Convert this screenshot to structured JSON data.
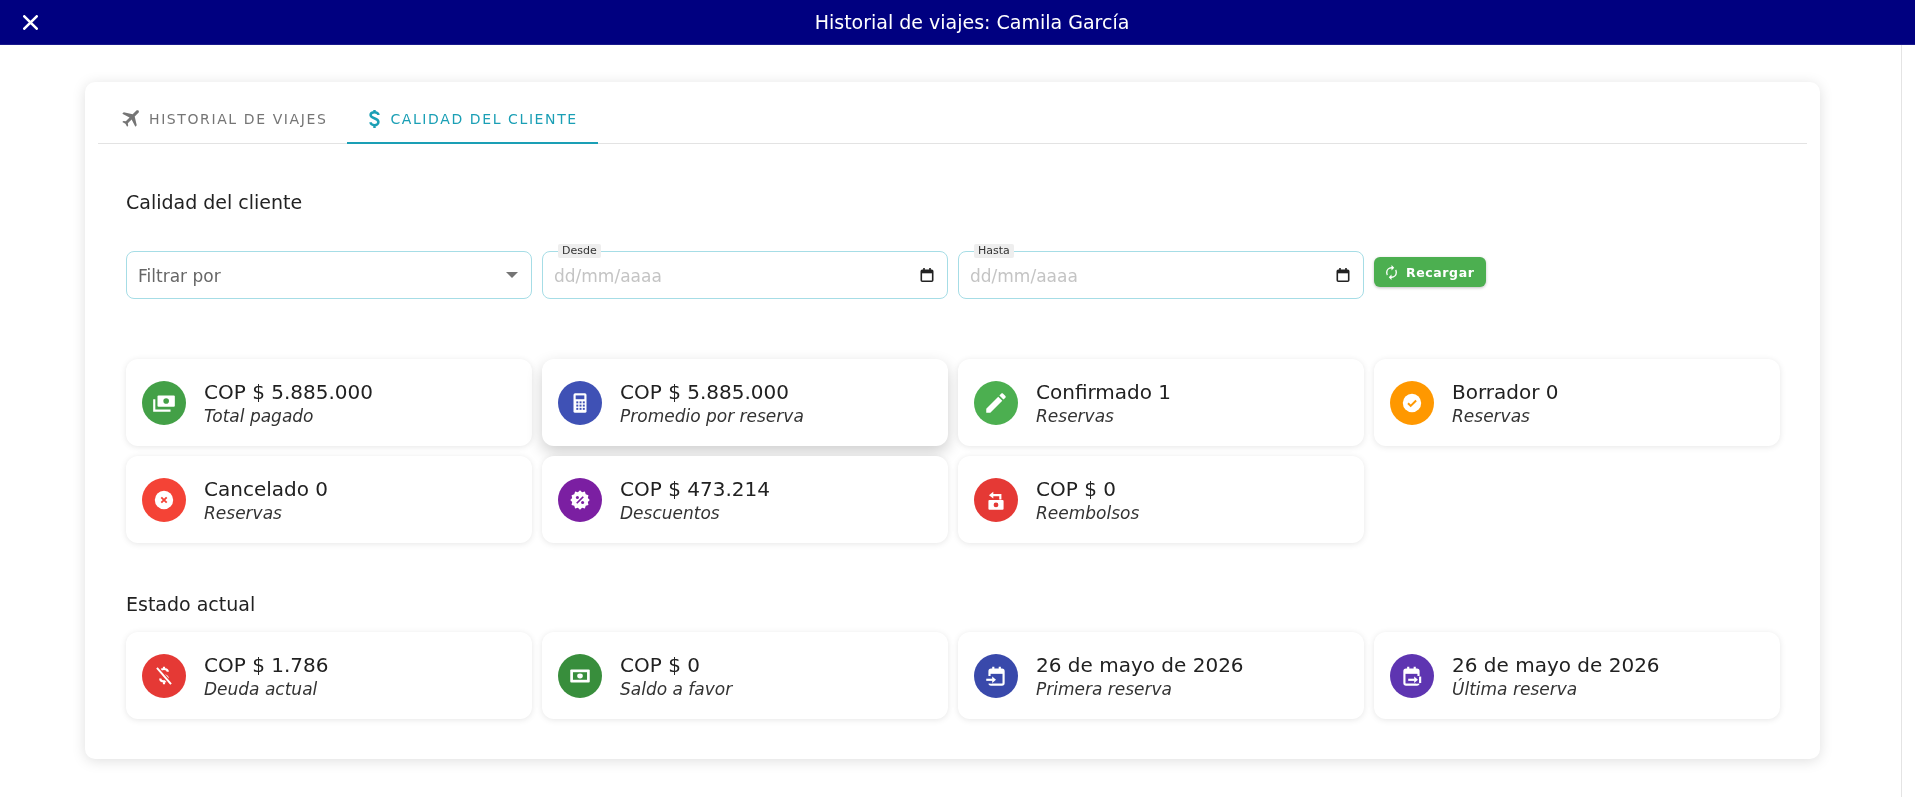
{
  "header": {
    "title": "Historial de viajes: Camila García"
  },
  "tabs": [
    {
      "label": "HISTORIAL DE VIAJES",
      "kind": "trips",
      "selected": false
    },
    {
      "label": "CALIDAD DEL CLIENTE",
      "kind": "quality",
      "selected": true
    }
  ],
  "customer_quality": {
    "title": "Calidad del cliente",
    "filters": {
      "filter_by": {
        "placeholder": "Filtrar por"
      },
      "from": {
        "label": "Desde",
        "placeholder": "dd/mm/aaaa"
      },
      "to": {
        "label": "Hasta",
        "placeholder": "dd/mm/aaaa"
      },
      "reload_button": "Recargar"
    },
    "stats": [
      {
        "kind": "payment",
        "value": "COP $ 5.885.000",
        "label": "Total pagado",
        "color": "#43a047",
        "hovered": false
      },
      {
        "kind": "average",
        "value": "COP $ 5.885.000",
        "label": "Promedio por reserva",
        "color": "#3f51b5",
        "hovered": true
      },
      {
        "kind": "confirmed",
        "value": "Confirmado 1",
        "label": "Reservas",
        "color": "#4caf50",
        "hovered": false
      },
      {
        "kind": "draft",
        "value": "Borrador 0",
        "label": "Reservas",
        "color": "#ff9800",
        "hovered": false
      },
      {
        "kind": "cancelled",
        "value": "Cancelado 0",
        "label": "Reservas",
        "color": "#f44336",
        "hovered": false
      },
      {
        "kind": "discount",
        "value": "COP $ 473.214",
        "label": "Descuentos",
        "color": "#7b1fa2",
        "hovered": false
      },
      {
        "kind": "refund",
        "value": "COP $ 0",
        "label": "Reembolsos",
        "color": "#e53935",
        "hovered": false
      }
    ]
  },
  "current_status": {
    "title": "Estado actual",
    "stats": [
      {
        "kind": "debt",
        "value": "COP $ 1.786",
        "label": "Deuda actual",
        "color": "#e53935",
        "hovered": false
      },
      {
        "kind": "credit",
        "value": "COP $ 0",
        "label": "Saldo a favor",
        "color": "#388e3c",
        "hovered": false
      },
      {
        "kind": "first",
        "value": "26 de mayo de 2026",
        "label": "Primera reserva",
        "color": "#3949ab",
        "hovered": false
      },
      {
        "kind": "last",
        "value": "26 de mayo de 2026",
        "label": "Última reserva",
        "color": "#5e35b1",
        "hovered": false
      }
    ]
  }
}
